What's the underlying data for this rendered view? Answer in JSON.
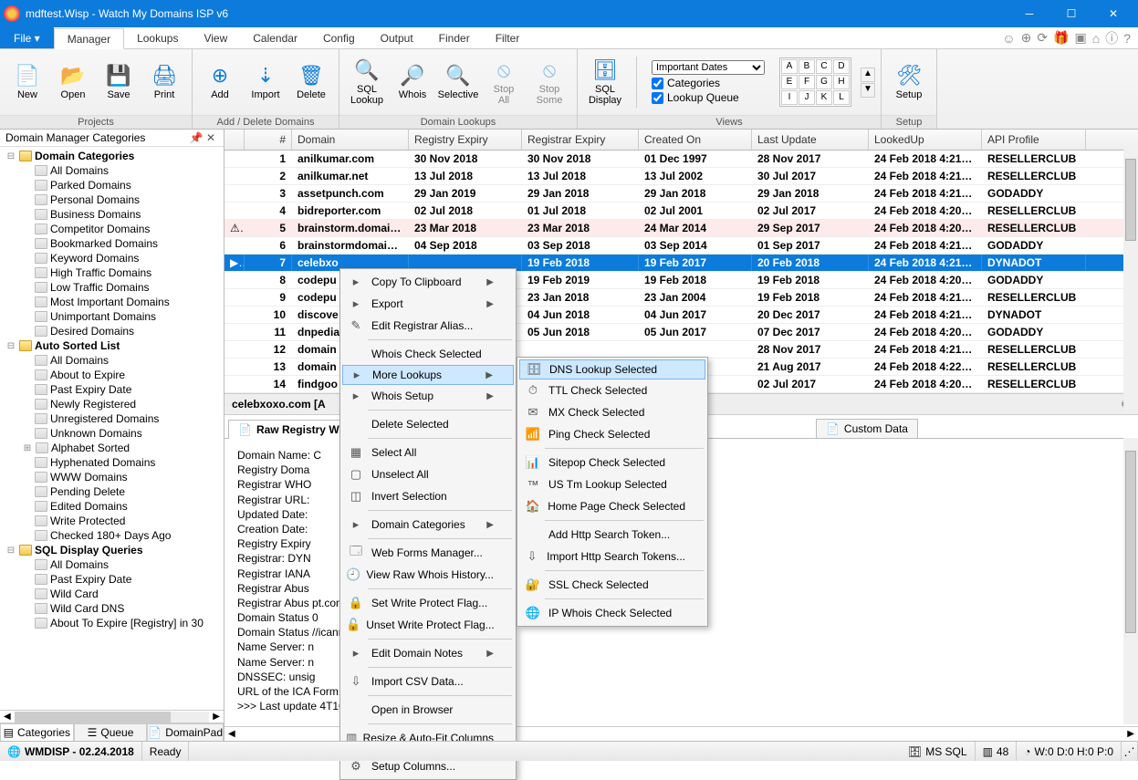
{
  "title": "mdftest.Wisp - Watch My Domains ISP v6",
  "menus": {
    "file": "File ▾",
    "items": [
      "Manager",
      "Lookups",
      "View",
      "Calendar",
      "Config",
      "Output",
      "Finder",
      "Filter"
    ]
  },
  "ribbon": {
    "projects": {
      "label": "Projects",
      "btns": [
        {
          "t": "New",
          "i": "📄"
        },
        {
          "t": "Open",
          "i": "📂"
        },
        {
          "t": "Save",
          "i": "💾"
        },
        {
          "t": "Print",
          "i": "🖨"
        }
      ]
    },
    "adddel": {
      "label": "Add / Delete Domains",
      "btns": [
        {
          "t": "Add",
          "i": "⊕"
        },
        {
          "t": "Import",
          "i": "⇣"
        },
        {
          "t": "Delete",
          "i": "🗑"
        }
      ]
    },
    "lookups": {
      "label": "Domain Lookups",
      "btns": [
        {
          "t": "SQL Lookup",
          "i": "🔍"
        },
        {
          "t": "Whois",
          "i": "🔎"
        },
        {
          "t": "Selective",
          "i": "🔍"
        },
        {
          "t": "Stop All",
          "i": "⦸",
          "d": true
        },
        {
          "t": "Stop Some",
          "i": "⦸",
          "d": true
        }
      ]
    },
    "views": {
      "label": "Views",
      "sql": "SQL Display",
      "dd": "Important Dates",
      "cb1": "Categories",
      "cb2": "Lookup Queue"
    },
    "setup": {
      "label": "Setup",
      "btn": {
        "t": "Setup",
        "i": "🛠"
      }
    }
  },
  "abc": [
    "A",
    "B",
    "C",
    "D",
    "E",
    "F",
    "G",
    "H",
    "I",
    "J",
    "K",
    "L"
  ],
  "sidebar": {
    "title": "Domain Manager Categories",
    "cats": {
      "title": "Domain Categories",
      "items": [
        "All Domains",
        "Parked Domains",
        "Personal Domains",
        "Business Domains",
        "Competitor Domains",
        "Bookmarked Domains",
        "Keyword Domains",
        "High Traffic Domains",
        "Low Traffic Domains",
        "Most Important Domains",
        "Unimportant Domains",
        "Desired Domains"
      ]
    },
    "auto": {
      "title": "Auto Sorted List",
      "items": [
        "All Domains",
        "About to Expire",
        "Past Expiry Date",
        "Newly Registered",
        "Unregistered Domains",
        "Unknown Domains",
        "Alphabet Sorted",
        "Hyphenated Domains",
        "WWW Domains",
        "Pending Delete",
        "Edited Domains",
        "Write Protected",
        "Checked 180+ Days Ago"
      ]
    },
    "sql": {
      "title": "SQL Display Queries",
      "items": [
        "All Domains",
        "Past Expiry Date",
        "Wild Card",
        "Wild Card DNS",
        "About To Expire [Registry] in 30"
      ]
    },
    "tabs": [
      "Categories",
      "Queue",
      "DomainPad"
    ]
  },
  "grid": {
    "cols": [
      "#",
      "Domain",
      "Registry Expiry",
      "Registrar Expiry",
      "Created On",
      "Last Update",
      "LookedUp",
      "API Profile"
    ],
    "rows": [
      {
        "n": "1",
        "d": "anilkumar.com",
        "re": "30 Nov 2018",
        "ra": "30 Nov 2018",
        "co": "01 Dec 1997",
        "lu": "28 Nov 2017",
        "lk": "24 Feb 2018 4:21:0…",
        "ap": "RESELLERCLUB"
      },
      {
        "n": "2",
        "d": "anilkumar.net",
        "re": "13 Jul 2018",
        "ra": "13 Jul 2018",
        "co": "13 Jul 2002",
        "lu": "30 Jul 2017",
        "lk": "24 Feb 2018 4:21:0…",
        "ap": "RESELLERCLUB"
      },
      {
        "n": "3",
        "d": "assetpunch.com",
        "re": "29 Jan 2019",
        "ra": "29 Jan 2018",
        "co": "29 Jan 2018",
        "lu": "29 Jan 2018",
        "lk": "24 Feb 2018 4:21:2…",
        "ap": "GODADDY"
      },
      {
        "n": "4",
        "d": "bidreporter.com",
        "re": "02 Jul 2018",
        "ra": "01 Jul 2018",
        "co": "02 Jul 2001",
        "lu": "02 Jul 2017",
        "lk": "24 Feb 2018 4:20:3…",
        "ap": "RESELLERCLUB"
      },
      {
        "n": "5",
        "d": "brainstorm.domai…",
        "re": "23 Mar 2018",
        "ra": "23 Mar 2018",
        "co": "24 Mar 2014",
        "lu": "29 Sep 2017",
        "lk": "24 Feb 2018 4:20:5…",
        "ap": "RESELLERCLUB",
        "warn": true,
        "ic": "⚠"
      },
      {
        "n": "6",
        "d": "brainstormdomain…",
        "re": "04 Sep 2018",
        "ra": "03 Sep 2018",
        "co": "03 Sep 2014",
        "lu": "01 Sep 2017",
        "lk": "24 Feb 2018 4:21:3…",
        "ap": "GODADDY"
      },
      {
        "n": "7",
        "d": "celebxo",
        "re": "",
        "ra": "19 Feb 2018",
        "co": "19 Feb 2017",
        "lu": "20 Feb 2018",
        "lk": "24 Feb 2018 4:21:1…",
        "ap": "DYNADOT",
        "sel": true,
        "ic": "▶"
      },
      {
        "n": "8",
        "d": "codepu",
        "re": "",
        "ra": "19 Feb 2019",
        "co": "19 Feb 2018",
        "lu": "19 Feb 2018",
        "lk": "24 Feb 2018 4:20:5…",
        "ap": "GODADDY"
      },
      {
        "n": "9",
        "d": "codepu",
        "re": "",
        "ra": "23 Jan 2018",
        "co": "23 Jan 2004",
        "lu": "19 Feb 2018",
        "lk": "24 Feb 2018 4:21:2…",
        "ap": "RESELLERCLUB"
      },
      {
        "n": "10",
        "d": "discove",
        "re": "",
        "ra": "04 Jun 2018",
        "co": "04 Jun 2017",
        "lu": "20 Dec 2017",
        "lk": "24 Feb 2018 4:21:2…",
        "ap": "DYNADOT"
      },
      {
        "n": "11",
        "d": "dnpedia",
        "re": "",
        "ra": "05 Jun 2018",
        "co": "05 Jun 2017",
        "lu": "07 Dec 2017",
        "lk": "24 Feb 2018 4:20:5…",
        "ap": "GODADDY"
      },
      {
        "n": "12",
        "d": "domain",
        "re": "",
        "ra": "",
        "co": "",
        "lu": "28 Nov 2017",
        "lk": "24 Feb 2018 4:21:5…",
        "ap": "RESELLERCLUB"
      },
      {
        "n": "13",
        "d": "domain",
        "re": "",
        "ra": "",
        "co": "",
        "lu": "21 Aug 2017",
        "lk": "24 Feb 2018 4:22:1…",
        "ap": "RESELLERCLUB"
      },
      {
        "n": "14",
        "d": "findgoo",
        "re": "",
        "ra": "",
        "co": "",
        "lu": "02 Jul 2017",
        "lk": "24 Feb 2018 4:20:0…",
        "ap": "RESELLERCLUB"
      }
    ]
  },
  "detail": {
    "title": "celebxoxo.com [A",
    "tabs": [
      "Raw Registry Wh",
      "",
      "",
      "",
      "Custom Data"
    ],
    "whois": "Domain Name: C\nRegistry Doma\nRegistrar WHO\nRegistrar URL:\nUpdated Date:\nCreation Date:\nRegistry Expiry\nRegistrar: DYN\nRegistrar IANA\nRegistrar Abus\nRegistrar Abus                                                          pt.com\nDomain Status                                                          0\nDomain Status                                   //icann.org/epp#clientTransferProhibited\nName Server: n\nName Server: n\nDNSSEC: unsig\nURL of the ICA                                                Form: https://www.icann.org/wicf/\n>>> Last update                                          4T10:50:33Z <<<\n\nFor more informa                                               ease visit https://icann.org/epp"
  },
  "ctx1": [
    {
      "t": "Copy To Clipboard",
      "ar": true
    },
    {
      "t": "Export",
      "ar": true
    },
    {
      "t": "Edit Registrar Alias...",
      "i": "✎"
    },
    {
      "sep": true
    },
    {
      "t": "Whois Check Selected"
    },
    {
      "t": "More Lookups",
      "ar": true,
      "hl": true
    },
    {
      "t": "Whois Setup",
      "ar": true
    },
    {
      "sep": true
    },
    {
      "t": "Delete Selected"
    },
    {
      "sep": true
    },
    {
      "t": "Select All",
      "i": "▦"
    },
    {
      "t": "Unselect All",
      "i": "▢"
    },
    {
      "t": "Invert Selection",
      "i": "◫"
    },
    {
      "sep": true
    },
    {
      "t": "Domain Categories",
      "ar": true
    },
    {
      "sep": true
    },
    {
      "t": "Web Forms Manager...",
      "i": "🗔"
    },
    {
      "t": "View Raw Whois History...",
      "i": "🕘"
    },
    {
      "sep": true
    },
    {
      "t": "Set Write Protect Flag...",
      "i": "🔒"
    },
    {
      "t": "Unset Write Protect Flag...",
      "i": "🔓"
    },
    {
      "sep": true
    },
    {
      "t": "Edit Domain Notes",
      "ar": true
    },
    {
      "sep": true
    },
    {
      "t": "Import CSV Data...",
      "i": "⇩"
    },
    {
      "sep": true
    },
    {
      "t": "Open in Browser"
    },
    {
      "sep": true
    },
    {
      "t": "Resize & Auto-Fit Columns",
      "i": "▥"
    },
    {
      "sep": true
    },
    {
      "t": "Setup Columns...",
      "i": "⚙"
    }
  ],
  "ctx2": [
    {
      "t": "DNS Lookup Selected",
      "i": "🗄",
      "hl": true
    },
    {
      "t": "TTL Check Selected",
      "i": "⏱"
    },
    {
      "t": "MX Check Selected",
      "i": "✉"
    },
    {
      "t": "Ping Check Selected",
      "i": "📶"
    },
    {
      "sep": true
    },
    {
      "t": "Sitepop Check Selected",
      "i": "📊"
    },
    {
      "t": "US Tm Lookup Selected",
      "i": "™"
    },
    {
      "t": "Home Page Check Selected",
      "i": "🏠"
    },
    {
      "sep": true
    },
    {
      "t": "Add Http Search Token..."
    },
    {
      "t": "Import Http Search Tokens...",
      "i": "⇩"
    },
    {
      "sep": true
    },
    {
      "t": "SSL Check Selected",
      "i": "🔐"
    },
    {
      "sep": true
    },
    {
      "t": "IP Whois Check Selected",
      "i": "🌐"
    }
  ],
  "status": {
    "app": "WMDISP - 02.24.2018",
    "ready": "Ready",
    "db": "MS SQL",
    "count": "48",
    "wdhp": "W:0 D:0 H:0 P:0"
  }
}
